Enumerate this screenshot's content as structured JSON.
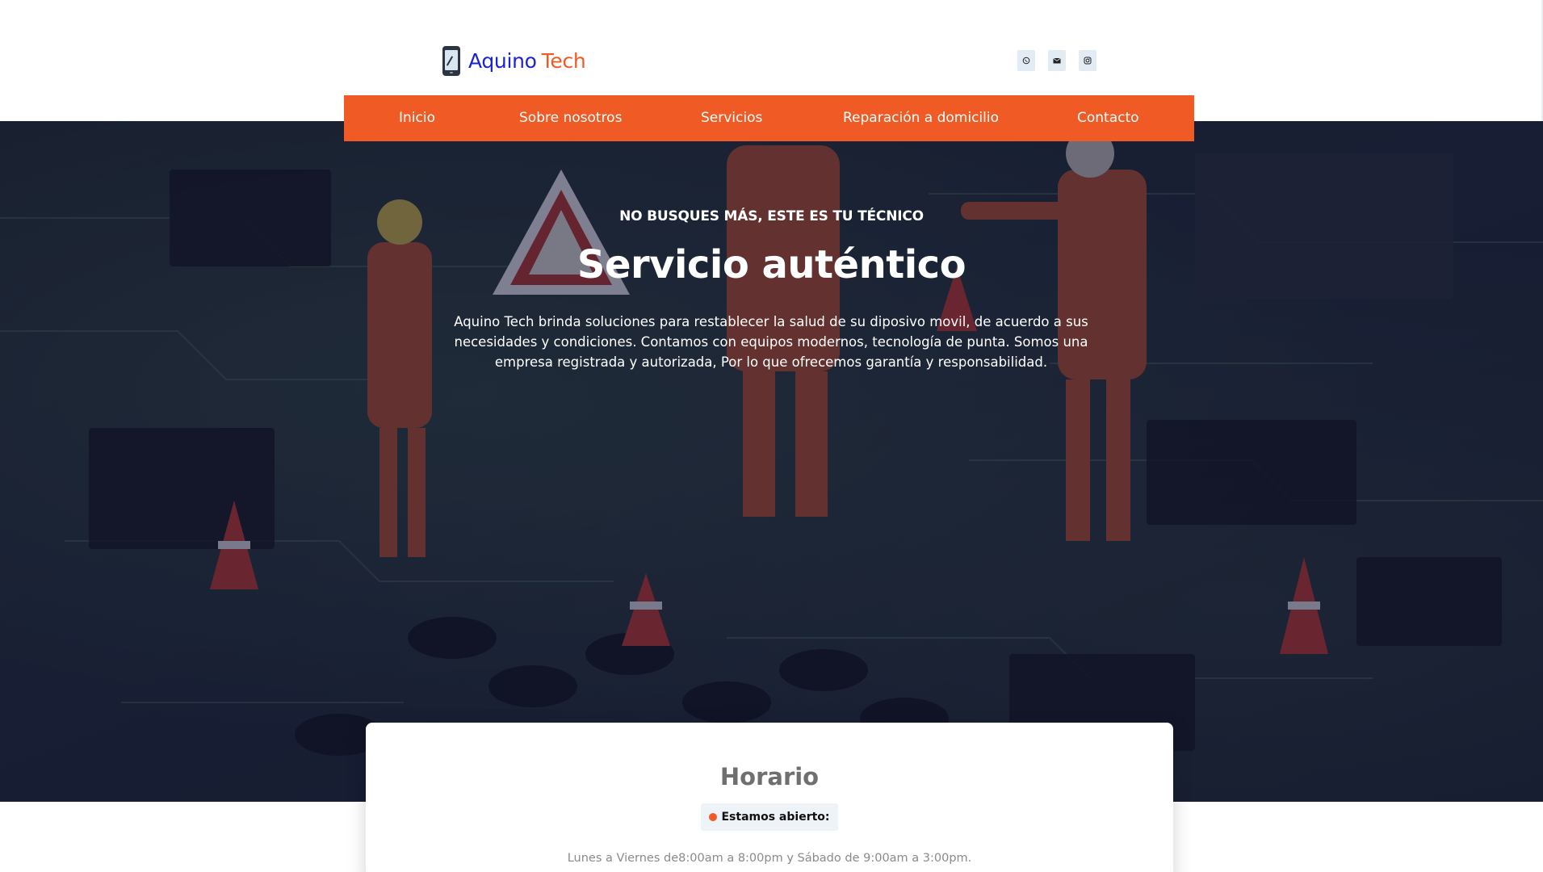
{
  "header": {
    "logo_part1": "Aquino",
    "logo_part2": "Tech",
    "social": [
      {
        "icon": "whatsapp-icon"
      },
      {
        "icon": "envelope-icon"
      },
      {
        "icon": "instagram-icon"
      }
    ]
  },
  "nav": {
    "items": [
      {
        "label": "Inicio"
      },
      {
        "label": "Sobre nosotros"
      },
      {
        "label": "Servicios"
      },
      {
        "label": "Reparación a domicilio"
      },
      {
        "label": "Contacto"
      }
    ]
  },
  "hero": {
    "kicker": "NO BUSQUES MÁS, ESTE ES TU TÉCNICO",
    "title": "Servicio auténtico",
    "text": "Aquino Tech brinda soluciones para restablecer la salud de su diposivo movil, de acuerdo a sus necesidades y condiciones. Contamos con equipos modernos, tecnología de punta. Somos una empresa registrada y autorizada, Por lo que ofrecemos garantía y responsabilidad."
  },
  "schedule": {
    "title": "Horario",
    "status": "Estamos abierto:",
    "hours": "Lunes a Viernes de8:00am a 8:00pm y Sábado de 9:00am a 3:00pm."
  },
  "colors": {
    "accent": "#f05a24",
    "brand_blue": "#1a24d6",
    "overlay": "#141634"
  }
}
